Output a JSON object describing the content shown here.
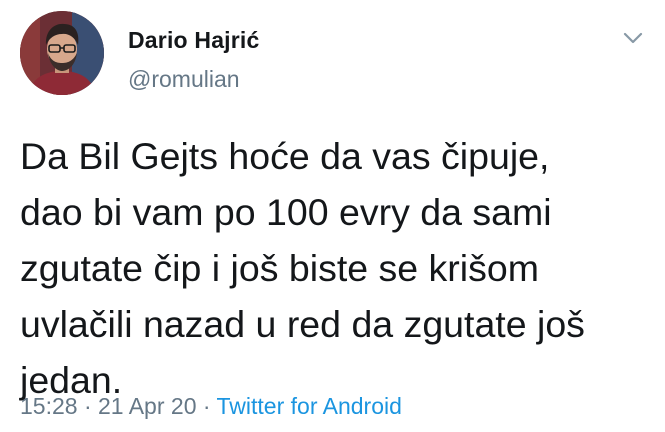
{
  "author": {
    "name": "Dario Hajrić",
    "handle": "@romulian"
  },
  "tweet": {
    "lines": [
      "Da Bil Gejts hoće da vas čipuje,",
      "dao bi vam po 100 evry da sami",
      "zgutate čip i još biste se krišom",
      "uvlačili nazad u red da zgutate još",
      "jedan."
    ]
  },
  "meta": {
    "time": "15:28",
    "date": "21 Apr 20",
    "separator": "·",
    "source": "Twitter for Android"
  },
  "icons": {
    "menu": "chevron-down-icon"
  },
  "colors": {
    "name": "#14171a",
    "secondary": "#657786",
    "link": "#1b95e0",
    "background": "#ffffff"
  }
}
